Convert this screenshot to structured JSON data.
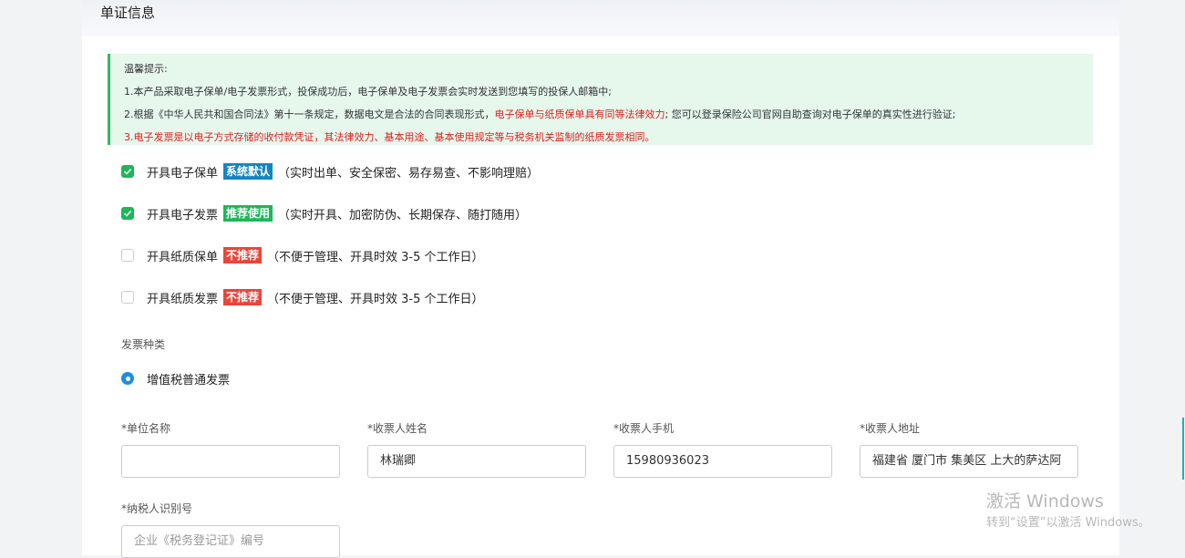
{
  "section": {
    "title": "单证信息"
  },
  "notice": {
    "heading": "温馨提示:",
    "line1": "1.本产品采取电子保单/电子发票形式，投保成功后，电子保单及电子发票会实时发送到您填写的投保人邮箱中;",
    "line2_part1": "2.根据《中华人民共和国合同法》第十一条规定，数据电文是合法的合同表现形式，",
    "line2_red": "电子保单与纸质保单具有同等法律效力",
    "line2_part3": "; 您可以登录保险公司官网自助查询对电子保单的真实性进行验证;",
    "line3": "3.电子发票是以电子方式存储的收付款凭证，其法律效力、基本用途、基本使用规定等与税务机关监制的纸质发票相同。"
  },
  "options": [
    {
      "label": "开具电子保单",
      "badge": "系统默认",
      "badge_color": "#1585c2",
      "desc": "（实时出单、安全保密、易存易查、不影响理赔）",
      "checked": true
    },
    {
      "label": "开具电子发票",
      "badge": "推荐使用",
      "badge_color": "#1fb65a",
      "desc": "（实时开具、加密防伪、长期保存、随打随用）",
      "checked": true
    },
    {
      "label": "开具纸质保单",
      "badge": "不推荐",
      "badge_color": "#e8463b",
      "desc": "（不便于管理、开具时效 3-5 个工作日）",
      "checked": false
    },
    {
      "label": "开具纸质发票",
      "badge": "不推荐",
      "badge_color": "#e8463b",
      "desc": "（不便于管理、开具时效 3-5 个工作日）",
      "checked": false
    }
  ],
  "invoice_type": {
    "label": "发票种类",
    "option": "增值税普通发票",
    "selected": true
  },
  "fields": {
    "company": {
      "label": "*单位名称",
      "value": ""
    },
    "recipient_name": {
      "label": "*收票人姓名",
      "value": "林瑞卿"
    },
    "recipient_phone": {
      "label": "*收票人手机",
      "value": "15980936023"
    },
    "recipient_address": {
      "label": "*收票人地址",
      "value": "福建省 厦门市 集美区 上大的萨达阿"
    },
    "taxpayer_id": {
      "label": "*纳税人识别号",
      "placeholder": "企业《税务登记证》编号"
    }
  },
  "watermark": {
    "line1": "激活 Windows",
    "line2": "转到“设置”以激活 Windows。"
  }
}
